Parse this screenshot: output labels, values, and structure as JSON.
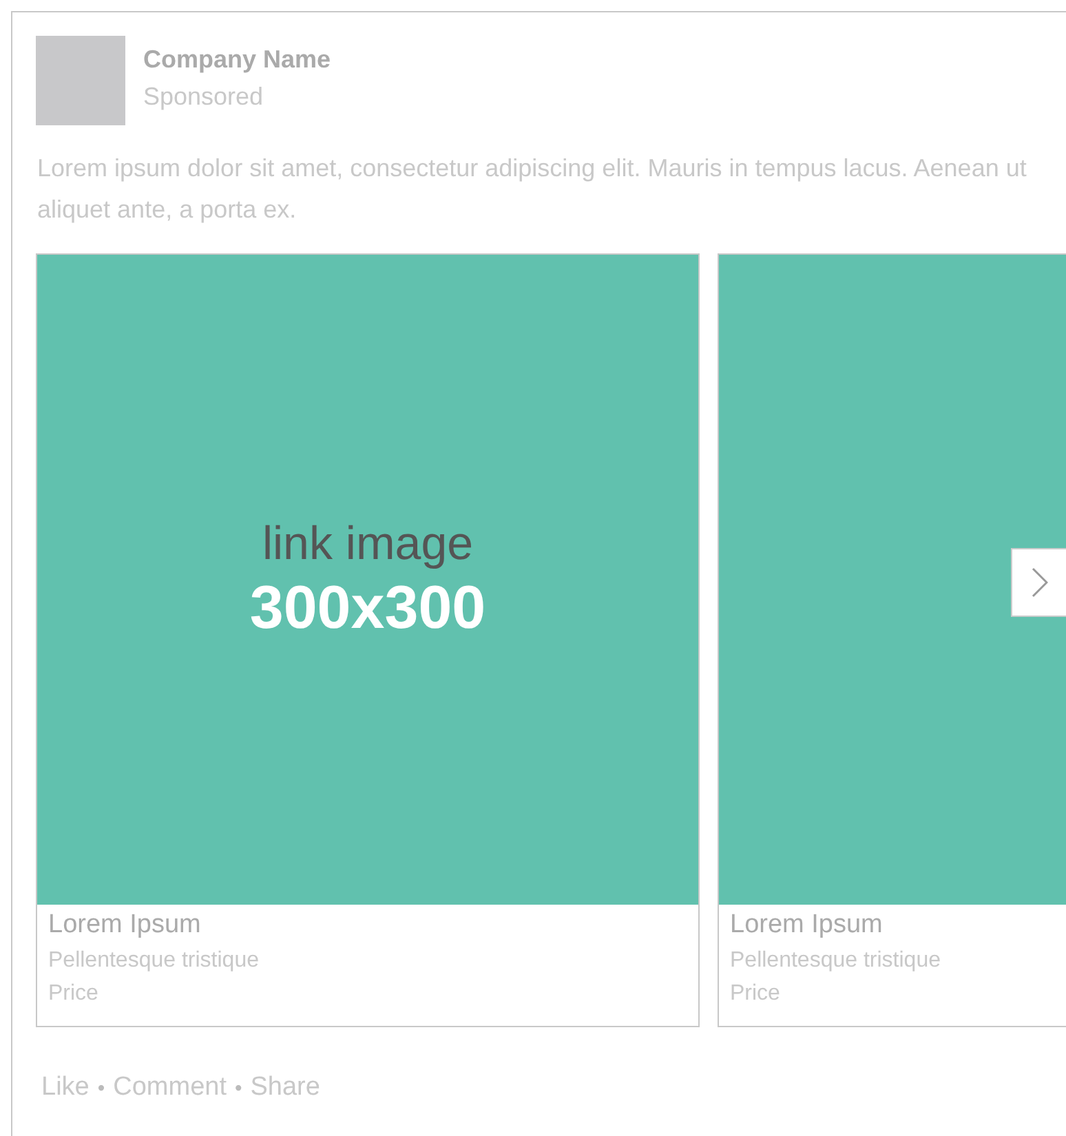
{
  "advertiser": {
    "name": "Company Name",
    "label": "Sponsored"
  },
  "message": "Lorem ipsum dolor sit amet, consectetur adipiscing elit. Mauris in tempus lacus. Aenean ut aliquet ante, a porta ex.",
  "cards": [
    {
      "image_caption": "link image",
      "image_size": "300x300",
      "title": "Lorem Ipsum",
      "subtitle": "Pellentesque tristique",
      "price": "Price"
    },
    {
      "title": "Lorem Ipsum",
      "subtitle": "Pellentesque tristique",
      "price": "Price"
    }
  ],
  "footer": [
    {
      "kind": "link",
      "text": "Like"
    },
    {
      "kind": "separator",
      "text": "•"
    },
    {
      "kind": "link",
      "text": "Comment"
    },
    {
      "kind": "separator",
      "text": "•"
    },
    {
      "kind": "link",
      "text": "Share"
    }
  ]
}
